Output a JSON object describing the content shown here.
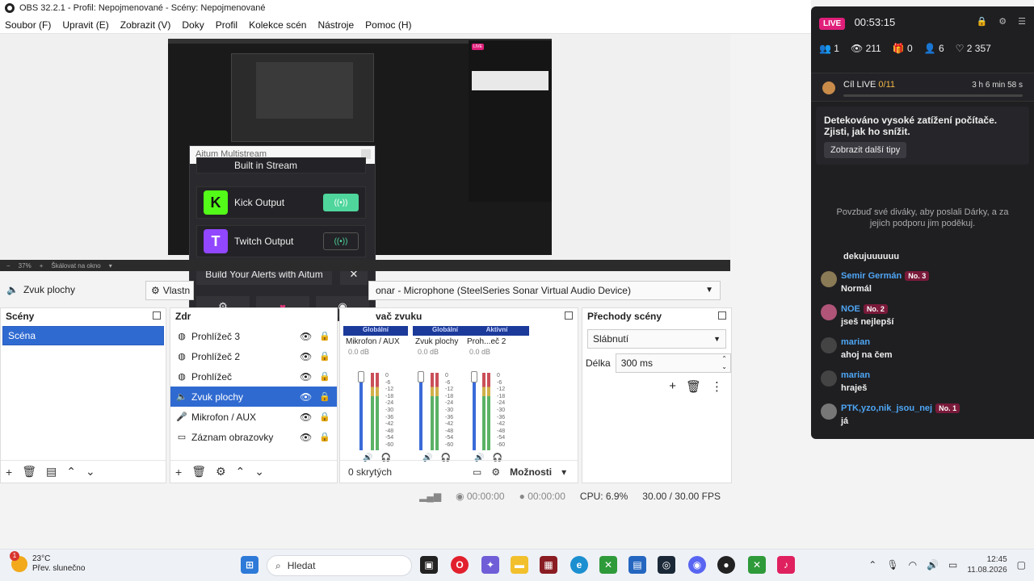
{
  "window": {
    "title": "OBS 32.2.1 - Profil: Nepojmenované - Scény: Nepojmenované"
  },
  "menu": [
    "Soubor (F)",
    "Upravit (E)",
    "Zobrazit (V)",
    "Doky",
    "Profil",
    "Kolekce scén",
    "Nástroje",
    "Pomoc (H)"
  ],
  "aitum": {
    "title": "Aitum Multistream",
    "partial_label": "Built in Stream",
    "outputs": [
      {
        "name": "Kick Output",
        "logo": "K",
        "color": "#53fc18",
        "active": true
      },
      {
        "name": "Twitch Output",
        "logo": "T",
        "color": "#9146ff",
        "active": false
      }
    ],
    "build_label": "Build Your Alerts with Aitum",
    "close_label": "✕"
  },
  "zoom": {
    "value": "37%",
    "mode": "Škálovat na okno"
  },
  "source_toolbar": {
    "source_name": "Zvuk plochy",
    "properties_label": "Vlastn",
    "device": "onar - Microphone (SteelSeries Sonar Virtual Audio Device)"
  },
  "scenes": {
    "title": "Scény",
    "items": [
      "Scéna"
    ]
  },
  "sources": {
    "title": "Zdr",
    "items": [
      {
        "name": "Prohlížeč 3",
        "icon": "globe-icon",
        "glyph": "◍",
        "selected": false,
        "locked": false
      },
      {
        "name": "Prohlížeč 2",
        "icon": "globe-icon",
        "glyph": "◍",
        "selected": false,
        "locked": false
      },
      {
        "name": "Prohlížeč",
        "icon": "globe-icon",
        "glyph": "◍",
        "selected": false,
        "locked": false
      },
      {
        "name": "Zvuk plochy",
        "icon": "speaker-icon",
        "glyph": "🔈",
        "selected": true,
        "locked": false
      },
      {
        "name": "Mikrofon / AUX",
        "icon": "microphone-icon",
        "glyph": "🎤",
        "selected": false,
        "locked": false
      },
      {
        "name": "Záznam obrazovky",
        "icon": "monitor-icon",
        "glyph": "▭",
        "selected": false,
        "locked": true
      }
    ]
  },
  "mixer": {
    "title": "vač zvuku",
    "channels": [
      {
        "tag": "Globální",
        "label": "Mikrofon / AUX",
        "db": "0.0 dB"
      },
      {
        "tag": "Globální",
        "label": "Zvuk plochy",
        "db": "0.0 dB"
      },
      {
        "tag": "Aktivní",
        "label": "Proh...eč 2",
        "db": "0.0 dB"
      }
    ],
    "scale": [
      "0",
      "-6",
      "-12",
      "-18",
      "-24",
      "-30",
      "-36",
      "-42",
      "-48",
      "-54",
      "-60"
    ],
    "hidden": "0 skrytých",
    "options": "Možnosti"
  },
  "transitions": {
    "title": "Přechody scény",
    "selected": "Slábnutí",
    "duration_label": "Délka",
    "duration_value": "300 ms"
  },
  "status": {
    "rec_time": "00:00:00",
    "stream_time": "00:00:00",
    "cpu": "CPU: 6.9%",
    "fps": "30.00 / 30.00 FPS"
  },
  "live": {
    "badge": "LIVE",
    "time": "00:53:15",
    "stats": {
      "viewers": "1",
      "views": "211",
      "gifts": "0",
      "followers": "6",
      "likes": "2 357"
    },
    "goal_label": "Cíl LIVE",
    "goal_value": "0/11",
    "goal_remaining": "3 h 6 min 58 s",
    "alert_text": "Detekováno vysoké zatížení počítače. Zjisti, jak ho snížit.",
    "alert_button": "Zobrazit další tipy",
    "hint": "Povzbuď své diváky, aby poslali Dárky, a za jejich podporu jim poděkuj.",
    "partial_msg": "dekujuuuuuu",
    "chat": [
      {
        "nick": "Semir Germán",
        "badge": "No. 3",
        "text": "Normál",
        "avatar": "#8a7a55"
      },
      {
        "nick": "NOE",
        "badge": "No. 2",
        "text": "jseš nejlepší",
        "avatar": "#b05577"
      },
      {
        "nick": "marian",
        "badge": "",
        "text": "ahoj na čem",
        "avatar": "#444"
      },
      {
        "nick": "marian",
        "badge": "",
        "text": "hraješ",
        "avatar": "#444"
      },
      {
        "nick": "PTK,yzo,nik_jsou_nej",
        "badge": "No. 1",
        "text": "já",
        "avatar": "#777"
      }
    ]
  },
  "taskbar": {
    "weather_temp": "23°C",
    "weather_desc": "Přev. slunečno",
    "notif_count": "1",
    "search": "Hledat",
    "time": "12:45",
    "date": "11.08.2026"
  }
}
